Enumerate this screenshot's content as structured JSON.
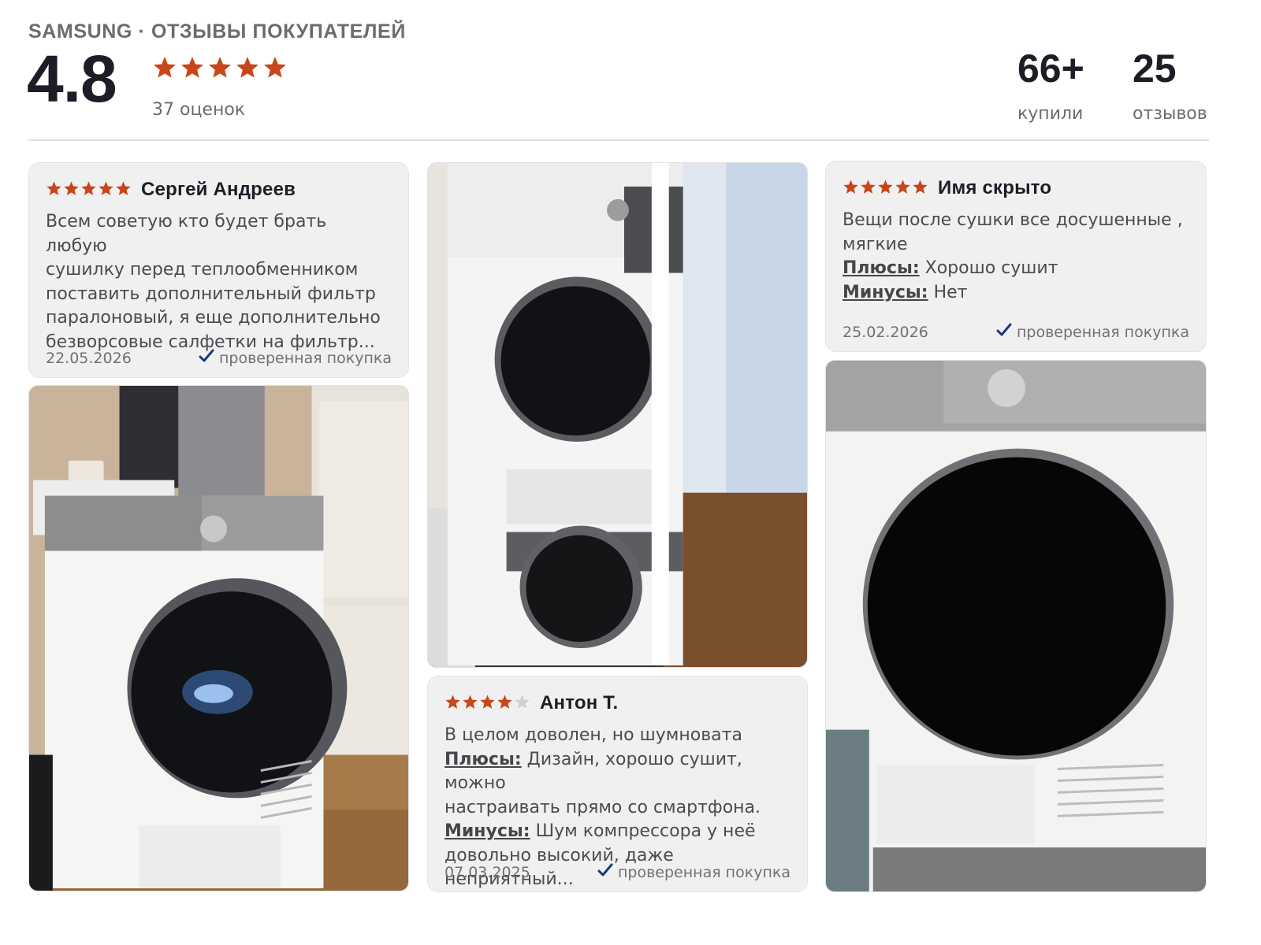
{
  "header": {
    "brand_line": "SAMSUNG · ОТЗЫВЫ ПОКУПАТЕЛЕЙ",
    "rating": "4.8",
    "rating_stars": 5,
    "ratings_count": "37 оценок",
    "bought_value": "66+",
    "bought_label": "купили",
    "reviews_value": "25",
    "reviews_label": "отзывов"
  },
  "colors": {
    "star": "#c8461a",
    "star_empty": "#d0d0d0",
    "check": "#1b3a7a",
    "card_bg": "#f0f0f0"
  },
  "reviews": [
    {
      "stars": 5,
      "author": "Сергей Андреев",
      "text_lines": [
        "Всем советую кто будет брать любую",
        "сушилку перед теплообменником",
        "поставить дополнительный фильтр",
        "паралоновый, я еще дополнительно",
        "безворсовые салфетки на фильтр..."
      ],
      "date": "22.05.2026",
      "verified": "проверенная покупка"
    },
    {
      "stars": 5,
      "author": "Имя скрыто",
      "text_lines": [
        "Вещи после сушки все досушенные ,",
        "мягкие"
      ],
      "pros_label": "Плюсы:",
      "pros": " Хорошо сушит",
      "cons_label": "Минусы:",
      "cons": " Нет",
      "date": "25.02.2026",
      "verified": "проверенная покупка"
    },
    {
      "stars": 4,
      "author": "Антон Т.",
      "text_lines": [
        "В целом доволен, но шумновата"
      ],
      "pros_label": "Плюсы:",
      "pros": " Дизайн, хорошо сушит, можно",
      "pros_line2": "настраивать прямо со смартфона.",
      "cons_label": "Минусы:",
      "cons": " Шум компрессора у неё",
      "cons_line2": "довольно высокий, даже неприятный...",
      "date": "07.03.2025",
      "verified": "проверенная покупка"
    }
  ],
  "photos": [
    {
      "name": "photo-dryer-kitchen"
    },
    {
      "name": "photo-dryer-stacked"
    },
    {
      "name": "photo-dryer-closeup"
    }
  ]
}
